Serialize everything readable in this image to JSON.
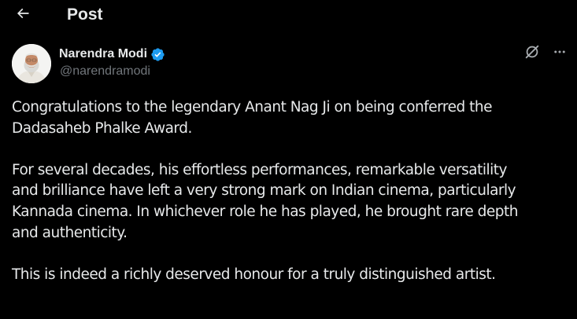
{
  "header": {
    "title": "Post",
    "back_icon": "arrow-left-icon"
  },
  "author": {
    "name": "Narendra Modi",
    "handle": "@narendramodi",
    "verified": true,
    "verified_color": "#1d9bf0"
  },
  "actions": {
    "grok_icon": "grok-icon",
    "more_icon": "more-horizontal-icon"
  },
  "post": {
    "paragraphs": [
      {
        "lines": [
          "Congratulations to the legendary Anant Nag Ji on being conferred the",
          "Dadasaheb Phalke Award."
        ]
      },
      {
        "lines": [
          "For several decades, his effortless performances, remarkable versatility",
          "and brilliance have left a very strong mark on Indian cinema, particularly",
          "Kannada cinema. In whichever role he has played, he brought rare depth",
          "and authenticity."
        ]
      },
      {
        "lines": [
          "This is indeed a richly deserved honour for a truly distinguished artist."
        ]
      }
    ]
  },
  "colors": {
    "background": "#000000",
    "text_primary": "#e7e9ea",
    "text_secondary": "#71767b"
  }
}
